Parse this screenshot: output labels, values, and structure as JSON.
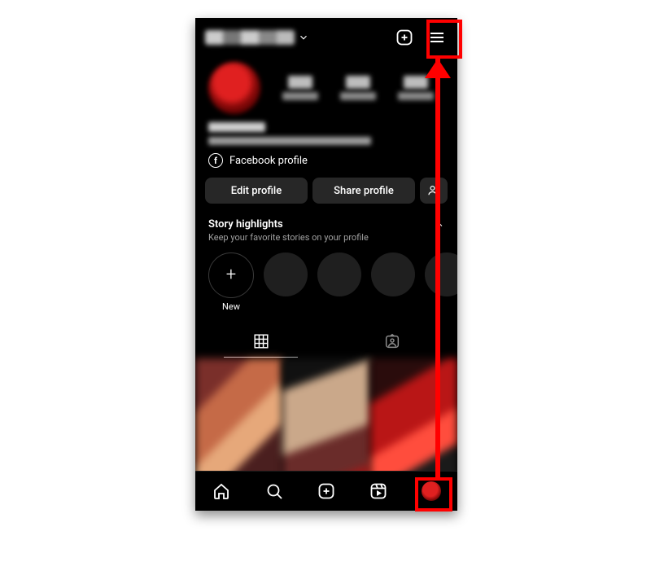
{
  "header": {
    "username_obscured": true
  },
  "facebook_link": {
    "label": "Facebook profile"
  },
  "action_buttons": {
    "edit": "Edit profile",
    "share": "Share profile"
  },
  "highlights": {
    "title": "Story highlights",
    "subtitle": "Keep your favorite stories on your profile",
    "new_label": "New"
  },
  "annotations": {
    "target_top": "hamburger-menu",
    "target_bottom": "profile-tab"
  }
}
